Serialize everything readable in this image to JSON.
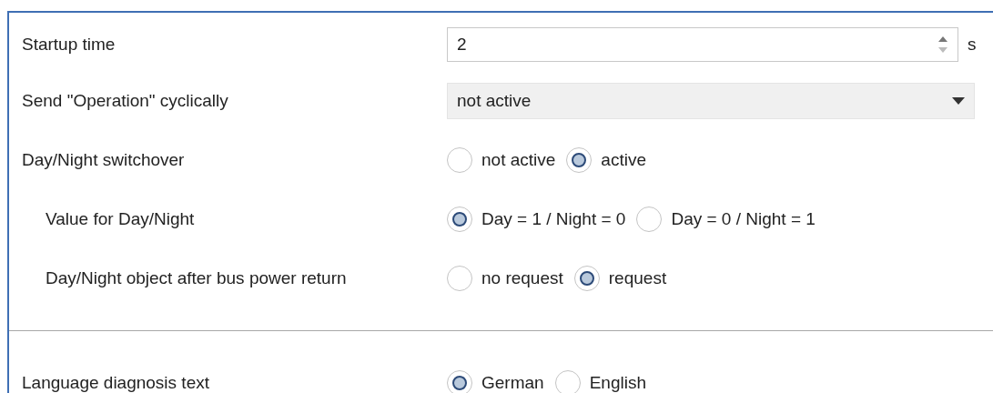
{
  "settings": [
    {
      "kind": "spin",
      "label": "Startup time",
      "value": "2",
      "unit": "s"
    },
    {
      "kind": "dropdown",
      "label": "Send \"Operation\" cyclically",
      "value": "not active"
    },
    {
      "kind": "radio",
      "label": "Day/Night switchover",
      "options": [
        {
          "label": "not active",
          "selected": false
        },
        {
          "label": "active",
          "selected": true
        }
      ],
      "children": [
        {
          "kind": "radio",
          "label": "Value for Day/Night",
          "options": [
            {
              "label": "Day = 1 / Night = 0",
              "selected": true
            },
            {
              "label": "Day = 0 / Night = 1",
              "selected": false
            }
          ]
        },
        {
          "kind": "radio",
          "label": "Day/Night object after bus power return",
          "options": [
            {
              "label": "no request",
              "selected": false
            },
            {
              "label": "request",
              "selected": true
            }
          ]
        }
      ]
    },
    {
      "kind": "separator"
    },
    {
      "kind": "radio",
      "label": "Language diagnosis text",
      "options": [
        {
          "label": "German",
          "selected": true
        },
        {
          "label": "English",
          "selected": false
        }
      ]
    }
  ]
}
